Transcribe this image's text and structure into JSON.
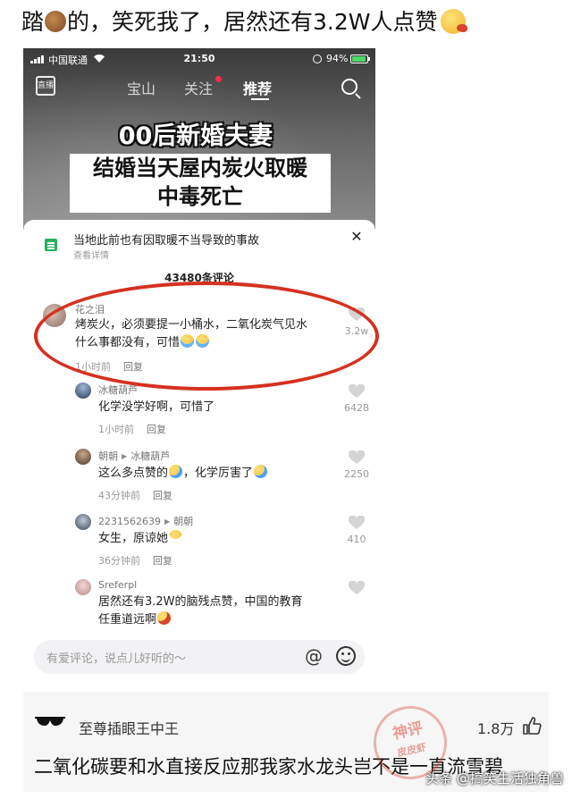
{
  "headline": {
    "part1": "踏",
    "part2": "的，笑死我了，居然还有3.2W人点赞",
    "dog_emoji": "dog-face-icon",
    "vomit_emoji": "vomiting-face-icon"
  },
  "status_bar": {
    "carrier": "中国联通",
    "time": "21:50",
    "battery": "94%"
  },
  "nav": {
    "live_label": "直播",
    "tabs": [
      "宝山",
      "关注",
      "推荐"
    ],
    "active_tab": "推荐"
  },
  "video": {
    "title": "00后新婚夫妻",
    "subtitle_line1": "结婚当天屋内炭火取暖",
    "subtitle_line2": "中毒死亡"
  },
  "notice": {
    "text": "当地此前也有因取暖不当导致的事故",
    "sub": "查看详情"
  },
  "comment_count": "43480条评论",
  "comments": [
    {
      "name": "花之泪",
      "text_line1": "烤炭火，必须要提一小桶水，二氧化炭气见水",
      "text_line2": "什么事都没有，可惜",
      "time": "1小时前",
      "reply": "回复",
      "likes": "3.2w",
      "emoji": "crying-face-icon"
    },
    {
      "name": "冰糖葫芦",
      "text": "化学没学好啊，可惜了",
      "time": "1小时前",
      "reply": "回复",
      "likes": "6428"
    },
    {
      "name": "朝朝",
      "reply_to": "冰糖葫芦",
      "text_a": "这么多点赞的",
      "text_b": "，化学厉害了",
      "time": "43分钟前",
      "reply": "回复",
      "likes": "2250",
      "emoji": "laughing-face-icon"
    },
    {
      "name": "2231562639",
      "reply_to": "朝朝",
      "text": "女生，原谅她",
      "time": "36分钟前",
      "reply": "回复",
      "likes": "410",
      "emoji": "grinning-face-icon"
    },
    {
      "name": "Sreferpl",
      "text_line1": "居然还有3.2W的脑残点赞，中国的教育",
      "text_line2": "任重道远啊",
      "emoji": "vomiting-face-icon"
    }
  ],
  "input": {
    "placeholder": "有爱评论，说点儿好听的～"
  },
  "bottom_comment": {
    "name": "至尊插眼王中王",
    "likes": "1.8万",
    "text": "二氧化碳要和水直接反应那我家水龙头岂不是一直流雪碧"
  },
  "stamp": {
    "line1": "神评",
    "line2": "皮皮虾"
  },
  "watermark": "头条 @搞笑生活独角兽",
  "colors": {
    "highlight_ellipse": "#d6311f",
    "notice_icon": "#27ae60",
    "tab_dot": "#ff2d55"
  }
}
